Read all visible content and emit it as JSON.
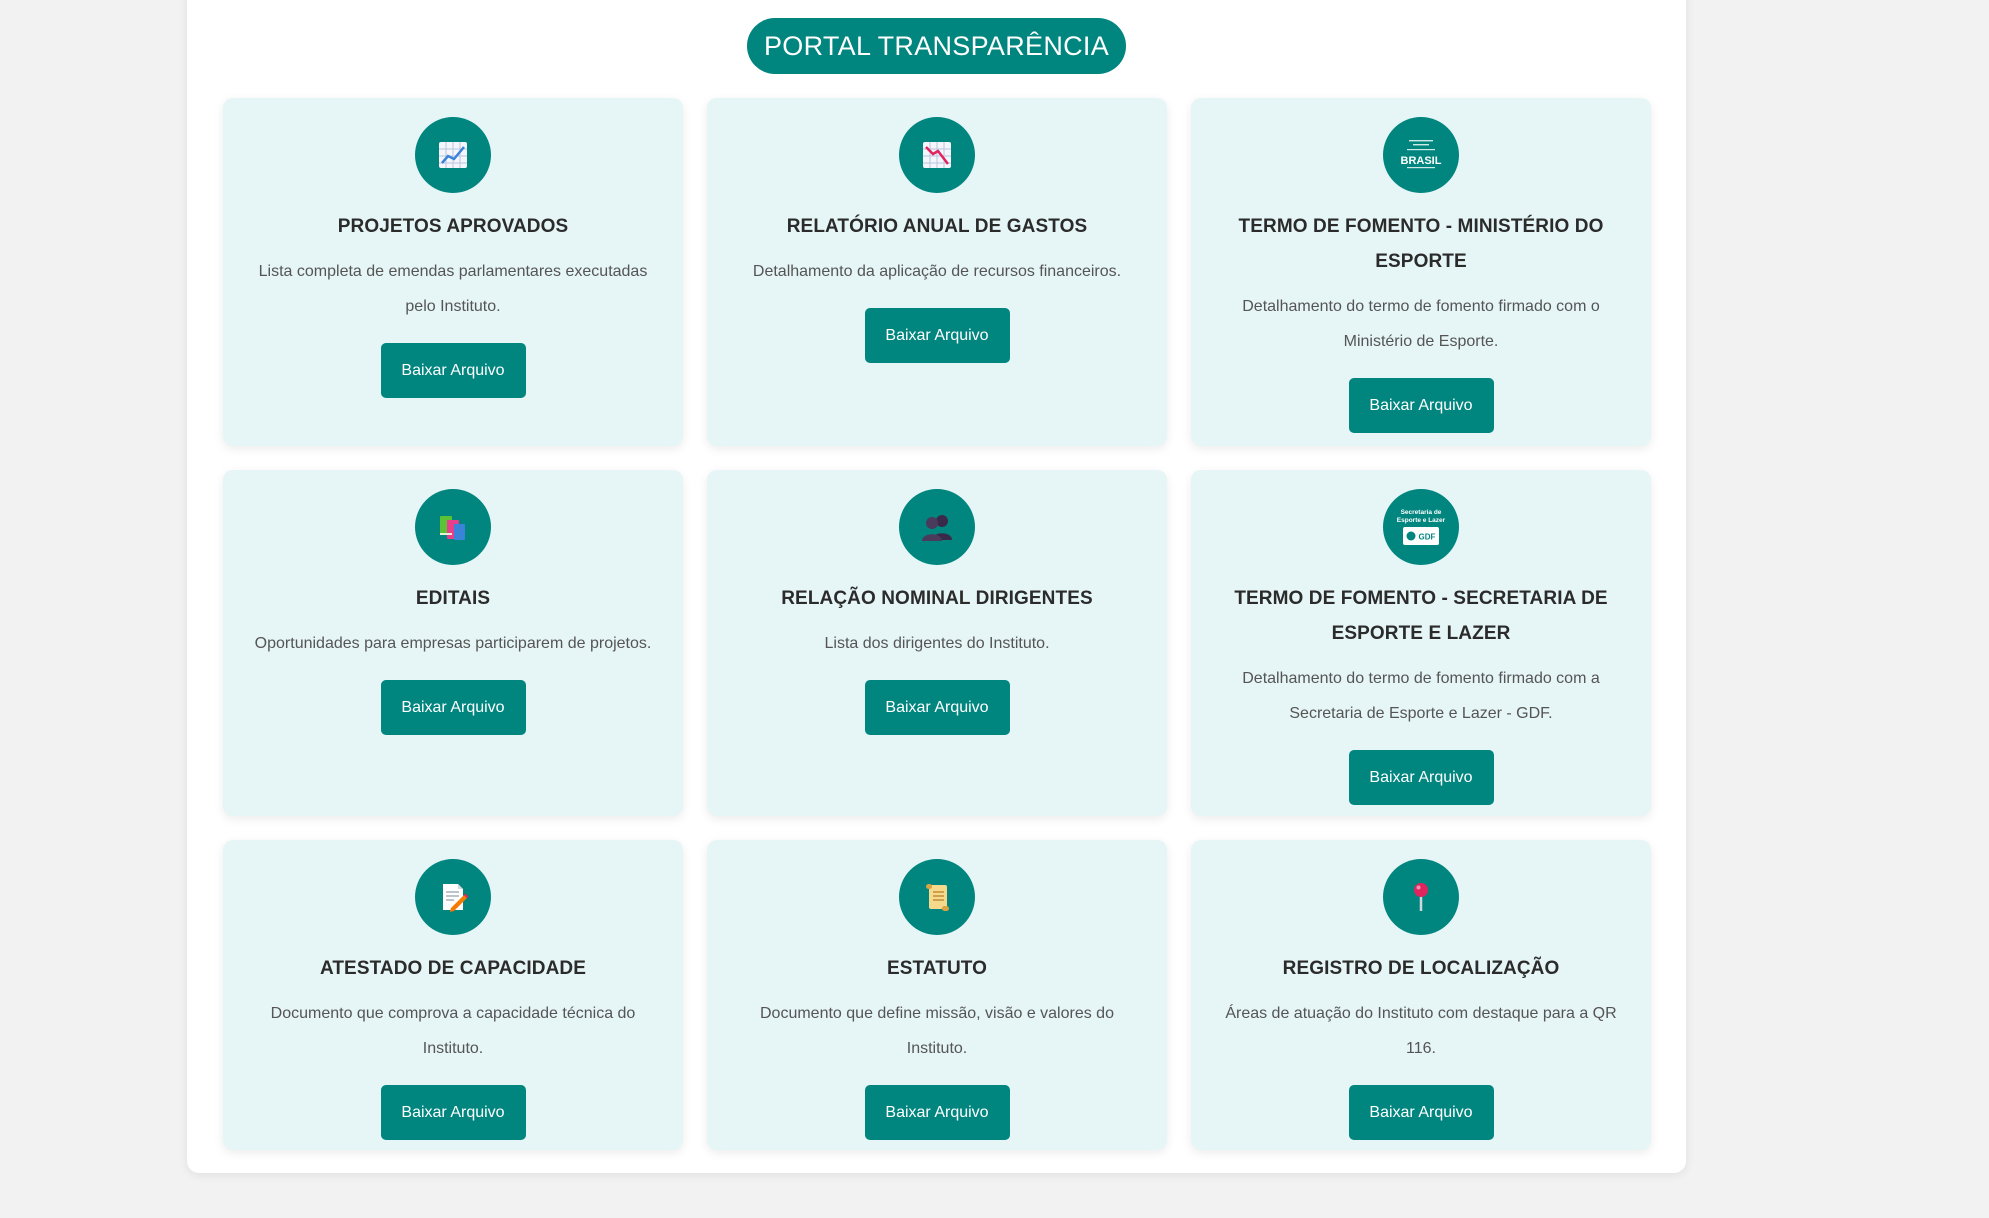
{
  "portal": {
    "title": "PORTAL TRANSPARÊNCIA"
  },
  "cards": [
    {
      "icon": "chart-increasing-icon",
      "title": "PROJETOS APROVADOS",
      "description": "Lista completa de emendas parlamentares executadas pelo Instituto.",
      "button": "Baixar Arquivo"
    },
    {
      "icon": "chart-decreasing-icon",
      "title": "RELATÓRIO ANUAL DE GASTOS",
      "description": "Detalhamento da aplicação de recursos financeiros.",
      "button": "Baixar Arquivo"
    },
    {
      "icon": "governo-federal-brasil-logo",
      "title": "TERMO DE FOMENTO - MINISTÉRIO DO ESPORTE",
      "description": "Detalhamento do termo de fomento firmado com o Ministério de Esporte.",
      "button": "Baixar Arquivo",
      "logo_text": "BRASIL"
    },
    {
      "icon": "books-icon",
      "title": "EDITAIS",
      "description": "Oportunidades para empresas participarem de projetos.",
      "button": "Baixar Arquivo"
    },
    {
      "icon": "busts-icon",
      "title": "RELAÇÃO NOMINAL DIRIGENTES",
      "description": "Lista dos dirigentes do Instituto.",
      "button": "Baixar Arquivo"
    },
    {
      "icon": "secretaria-esporte-lazer-gdf-logo",
      "title": "TERMO DE FOMENTO - SECRETARIA DE ESPORTE E LAZER",
      "description": "Detalhamento do termo de fomento firmado com a Secretaria de Esporte e Lazer - GDF.",
      "button": "Baixar Arquivo",
      "logo_text_line1": "Secretaria de",
      "logo_text_line2": "Esporte e Lazer",
      "logo_text_badge": "GDF"
    },
    {
      "icon": "memo-pencil-icon",
      "title": "ATESTADO DE CAPACIDADE",
      "description": "Documento que comprova a capacidade técnica do Instituto.",
      "button": "Baixar Arquivo"
    },
    {
      "icon": "scroll-icon",
      "title": "ESTATUTO",
      "description": "Documento que define missão, visão e valores do Instituto.",
      "button": "Baixar Arquivo"
    },
    {
      "icon": "round-pushpin-icon",
      "title": "REGISTRO DE LOCALIZAÇÃO",
      "description": "Áreas de atuação do Instituto com destaque para a QR 116.",
      "button": "Baixar Arquivo"
    }
  ],
  "colors": {
    "primary": "#00857f",
    "card_bg": "#e6f5f6",
    "page_bg": "#f2f2f2"
  }
}
